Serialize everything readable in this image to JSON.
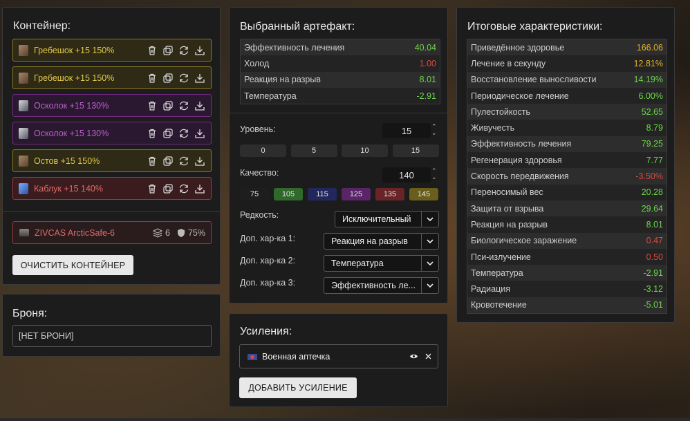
{
  "container": {
    "title": "Контейнер:",
    "items": [
      {
        "label": "Гребешок +15 150%",
        "tier": "gold"
      },
      {
        "label": "Гребешок +15 150%",
        "tier": "gold"
      },
      {
        "label": "Осколок +15 130%",
        "tier": "purple"
      },
      {
        "label": "Осколок +15 130%",
        "tier": "purple"
      },
      {
        "label": "Остов +15 150%",
        "tier": "gold"
      },
      {
        "label": "Каблук +15 140%",
        "tier": "red"
      }
    ],
    "case": {
      "label": "ZIVCAS ArcticSafe-6",
      "slots": "6",
      "protection": "75%"
    },
    "clear_button": "ОЧИСТИТЬ КОНТЕЙНЕР"
  },
  "armor": {
    "title": "Броня:",
    "value": "[НЕТ БРОНИ]"
  },
  "artifact": {
    "title": "Выбранный артефакт:",
    "stats": [
      {
        "name": "Эффективность лечения",
        "value": "40.04",
        "tone": "pos"
      },
      {
        "name": "Холод",
        "value": "1.00",
        "tone": "neg"
      },
      {
        "name": "Реакция на разрыв",
        "value": "8.01",
        "tone": "pos"
      },
      {
        "name": "Температура",
        "value": "-2.91",
        "tone": "pos"
      }
    ],
    "level_label": "Уровень:",
    "level_value": "15",
    "level_presets": [
      "0",
      "5",
      "10",
      "15"
    ],
    "quality_label": "Качество:",
    "quality_value": "140",
    "quality_presets": [
      {
        "label": "75",
        "color": "#1e1e1e"
      },
      {
        "label": "105",
        "color": "#2f6a2a"
      },
      {
        "label": "115",
        "color": "#22285e"
      },
      {
        "label": "125",
        "color": "#5a2468"
      },
      {
        "label": "135",
        "color": "#6a2428"
      },
      {
        "label": "145",
        "color": "#6a5e1c"
      }
    ],
    "rarity_label": "Редкость:",
    "rarity_value": "Исключительный",
    "extra1_label": "Доп. хар-ка 1:",
    "extra1_value": "Реакция на разрыв",
    "extra2_label": "Доп. хар-ка 2:",
    "extra2_value": "Температура",
    "extra3_label": "Доп. хар-ка 3:",
    "extra3_value": "Эффективность ле..."
  },
  "boosts": {
    "title": "Усиления:",
    "item": "Военная аптечка",
    "add_button": "ДОБАВИТЬ УСИЛЕНИЕ"
  },
  "totals": {
    "title": "Итоговые характеристики:",
    "stats": [
      {
        "name": "Приведённое здоровье",
        "value": "166.06",
        "tone": "amb"
      },
      {
        "name": "Лечение в секунду",
        "value": "12.81%",
        "tone": "amb"
      },
      {
        "name": "Восстановление выносливости",
        "value": "14.19%",
        "tone": "pos"
      },
      {
        "name": "Периодическое лечение",
        "value": "6.00%",
        "tone": "pos"
      },
      {
        "name": "Пулестойкость",
        "value": "52.65",
        "tone": "pos"
      },
      {
        "name": "Живучесть",
        "value": "8.79",
        "tone": "pos"
      },
      {
        "name": "Эффективность лечения",
        "value": "79.25",
        "tone": "pos"
      },
      {
        "name": "Регенерация здоровья",
        "value": "7.77",
        "tone": "pos"
      },
      {
        "name": "Скорость передвижения",
        "value": "-3.50%",
        "tone": "neg"
      },
      {
        "name": "Переносимый вес",
        "value": "20.28",
        "tone": "pos"
      },
      {
        "name": "Защита от взрыва",
        "value": "29.64",
        "tone": "pos"
      },
      {
        "name": "Реакция на разрыв",
        "value": "8.01",
        "tone": "pos"
      },
      {
        "name": "Биологическое заражение",
        "value": "0.47",
        "tone": "neg"
      },
      {
        "name": "Пси-излучение",
        "value": "0.50",
        "tone": "neg"
      },
      {
        "name": "Температура",
        "value": "-2.91",
        "tone": "pos"
      },
      {
        "name": "Радиация",
        "value": "-3.12",
        "tone": "pos"
      },
      {
        "name": "Кровотечение",
        "value": "-5.01",
        "tone": "pos"
      }
    ]
  }
}
